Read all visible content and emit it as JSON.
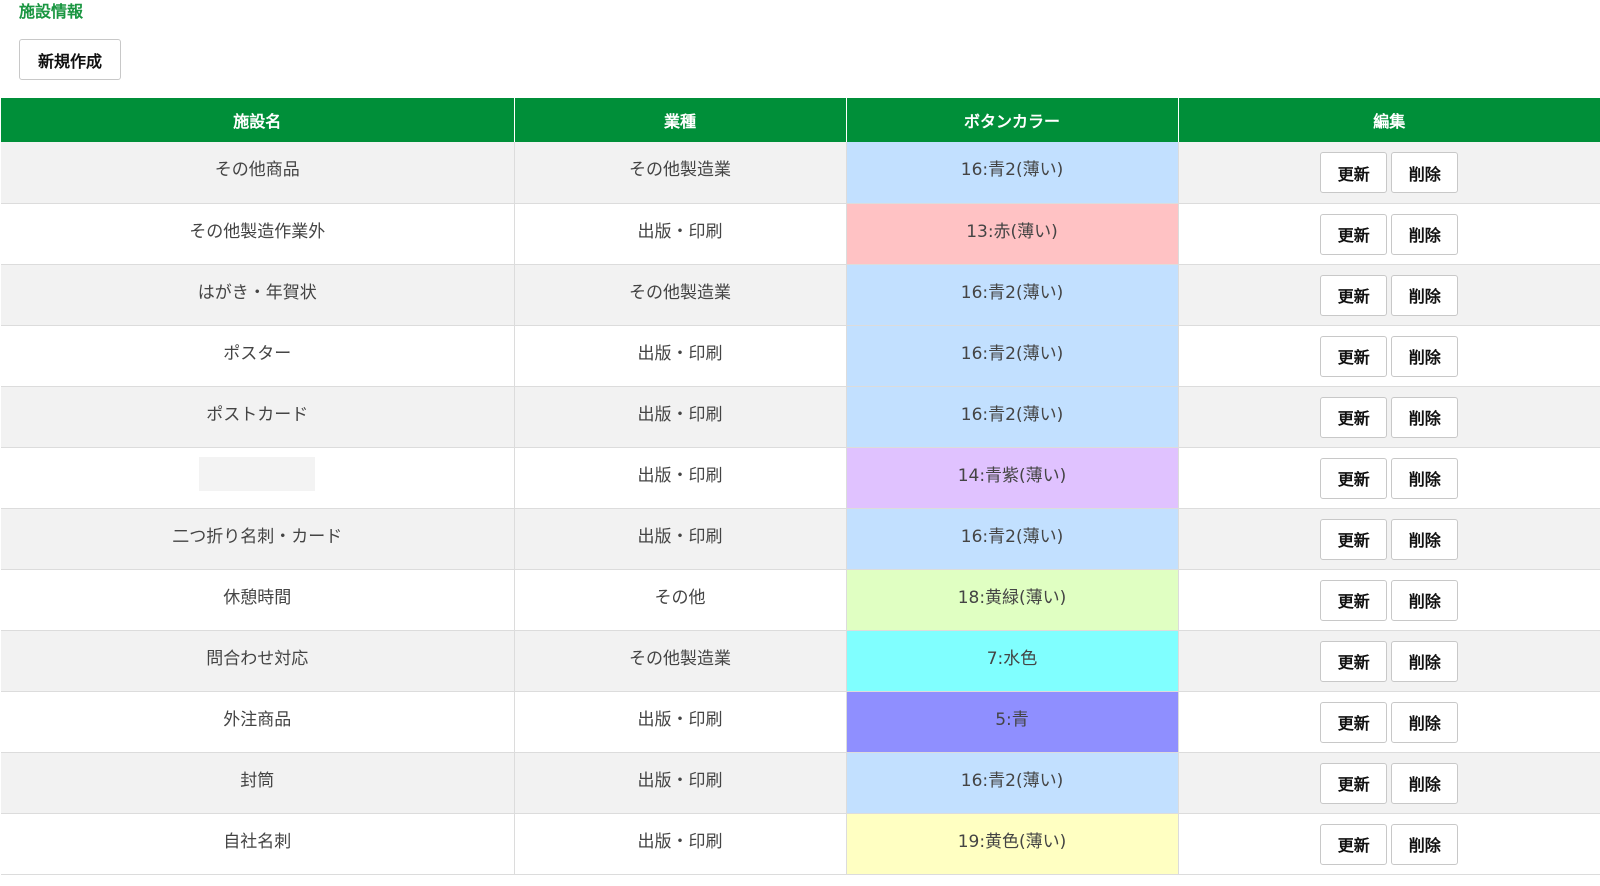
{
  "page": {
    "title": "施設情報"
  },
  "toolbar": {
    "new_label": "新規作成"
  },
  "table": {
    "columns": [
      "施設名",
      "業種",
      "ボタンカラー",
      "編集"
    ],
    "update_label": "更新",
    "delete_label": "削除",
    "rows": [
      {
        "name": "その他商品",
        "industry": "その他製造業",
        "color_label": "16:青2(薄い)",
        "color": "#c2e0ff"
      },
      {
        "name": "その他製造作業外",
        "industry": "出版・印刷",
        "color_label": "13:赤(薄い)",
        "color": "#ffc2c4"
      },
      {
        "name": "はがき・年賀状",
        "industry": "その他製造業",
        "color_label": "16:青2(薄い)",
        "color": "#c2e0ff"
      },
      {
        "name": "ポスター",
        "industry": "出版・印刷",
        "color_label": "16:青2(薄い)",
        "color": "#c2e0ff"
      },
      {
        "name": "ポストカード",
        "industry": "出版・印刷",
        "color_label": "16:青2(薄い)",
        "color": "#c2e0ff"
      },
      {
        "name": "",
        "industry": "出版・印刷",
        "color_label": "14:青紫(薄い)",
        "color": "#e0c2ff"
      },
      {
        "name": "二つ折り名刺・カード",
        "industry": "出版・印刷",
        "color_label": "16:青2(薄い)",
        "color": "#c2e0ff"
      },
      {
        "name": "休憩時間",
        "industry": "その他",
        "color_label": "18:黄緑(薄い)",
        "color": "#e0ffc2"
      },
      {
        "name": "問合わせ対応",
        "industry": "その他製造業",
        "color_label": "7:水色",
        "color": "#80ffff"
      },
      {
        "name": "外注商品",
        "industry": "出版・印刷",
        "color_label": "5:青",
        "color": "#8f8fff"
      },
      {
        "name": "封筒",
        "industry": "出版・印刷",
        "color_label": "16:青2(薄い)",
        "color": "#c2e0ff"
      },
      {
        "name": "自社名刺",
        "industry": "出版・印刷",
        "color_label": "19:黄色(薄い)",
        "color": "#ffffc2"
      }
    ]
  }
}
